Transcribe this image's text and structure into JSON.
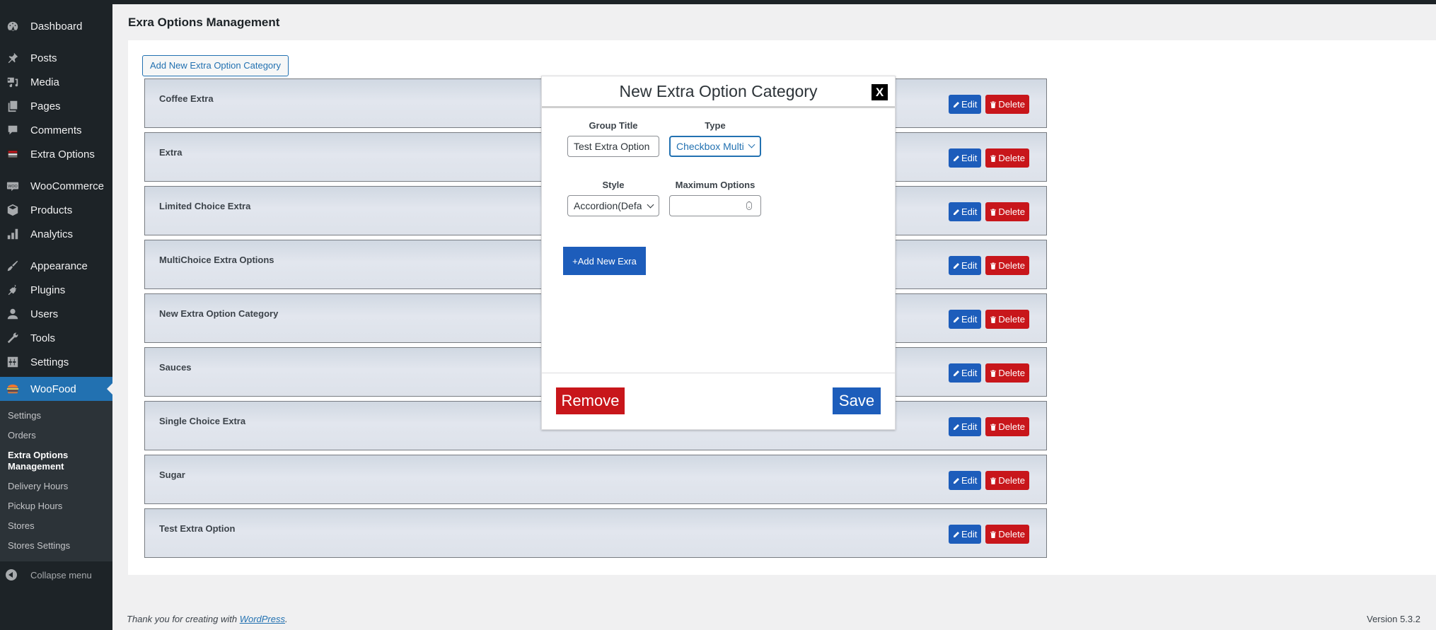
{
  "sidebar": {
    "items": [
      {
        "label": "Dashboard",
        "icon": "dashboard-icon"
      },
      {
        "label": "Posts",
        "icon": "pin-icon"
      },
      {
        "label": "Media",
        "icon": "media-icon"
      },
      {
        "label": "Pages",
        "icon": "pages-icon"
      },
      {
        "label": "Comments",
        "icon": "comment-icon"
      },
      {
        "label": "Extra Options",
        "icon": "woofood-logo-icon"
      },
      {
        "label": "WooCommerce",
        "icon": "woocommerce-icon"
      },
      {
        "label": "Products",
        "icon": "box-icon"
      },
      {
        "label": "Analytics",
        "icon": "bar-chart-icon"
      },
      {
        "label": "Appearance",
        "icon": "paintbrush-icon"
      },
      {
        "label": "Plugins",
        "icon": "plug-icon"
      },
      {
        "label": "Users",
        "icon": "user-icon"
      },
      {
        "label": "Tools",
        "icon": "wrench-icon"
      },
      {
        "label": "Settings",
        "icon": "sliders-icon"
      },
      {
        "label": "WooFood",
        "icon": "burger-icon"
      }
    ],
    "submenu": [
      {
        "label": "Settings"
      },
      {
        "label": "Orders"
      },
      {
        "label": "Extra Options Management"
      },
      {
        "label": "Delivery Hours"
      },
      {
        "label": "Pickup Hours"
      },
      {
        "label": "Stores"
      },
      {
        "label": "Stores Settings"
      }
    ],
    "collapse_label": "Collapse menu"
  },
  "page": {
    "title": "Exra Options Management",
    "add_category_label": "Add New Extra Option Category",
    "categories": [
      {
        "title": "Coffee Extra"
      },
      {
        "title": "Extra"
      },
      {
        "title": "Limited Choice Extra"
      },
      {
        "title": "MultiChoice Extra Options"
      },
      {
        "title": "New Extra Option Category"
      },
      {
        "title": "Sauces"
      },
      {
        "title": "Single Choice Extra"
      },
      {
        "title": "Sugar"
      },
      {
        "title": "Test Extra Option"
      }
    ],
    "edit_label": "Edit",
    "delete_label": "Delete"
  },
  "modal": {
    "title": "New Extra Option Category",
    "close_label": "X",
    "group_title_label": "Group Title",
    "group_title_value": "Test Extra Option",
    "type_label": "Type",
    "type_value": "Checkbox Multiple",
    "style_label": "Style",
    "style_value": "Accordion(Default)",
    "max_options_label": "Maximum Options",
    "max_options_value": "",
    "add_extra_label": "+Add New Exra",
    "remove_label": "Remove",
    "save_label": "Save"
  },
  "footer": {
    "thanks_prefix": "Thank you for creating with ",
    "thanks_link": "WordPress",
    "thanks_suffix": ".",
    "version": "Version 5.3.2"
  },
  "colors": {
    "primary_blue": "#1d5dbb",
    "danger_red": "#c8161b",
    "wp_blue": "#2271b1",
    "sidebar_bg": "#1d2327"
  }
}
